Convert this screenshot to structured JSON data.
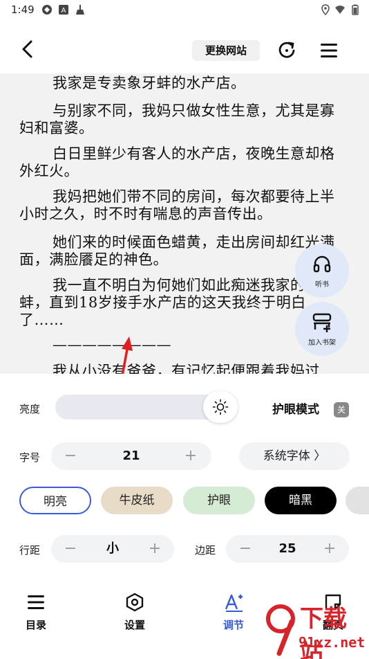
{
  "status_bar": {
    "time": "1:49"
  },
  "top_bar": {
    "switch_site": "更换网站"
  },
  "content": {
    "paragraphs": [
      "我家是专卖象牙蚌的水产店。",
      "与别家不同，我妈只做女性生意，尤其是寡妇和富婆。",
      "白日里鲜少有客人的水产店，夜晚生意却格外红火。",
      "我妈把她们带不同的房间，每次都要待上半小时之久，时不时有喘息的声音传出。",
      "她们来的时候面色蜡黄，走出房间却红光满面，满脸餍足的神色。",
      "我一直不明白为何她们如此痴迷我家的象牙蚌，直到18岁接手水产店的这天我终于明白了……",
      "————————",
      "我从小没有爸爸，有记忆起便跟着我妈过"
    ]
  },
  "floating": {
    "listen": "听书",
    "add_shelf": "加入书架"
  },
  "settings": {
    "brightness_label": "亮度",
    "eye_mode_label": "护眼模式",
    "eye_mode_state": "关",
    "font_size_label": "字号",
    "font_size_value": "21",
    "font_family_label": "系统字体 〉",
    "minus": "−",
    "plus": "+",
    "themes": [
      "明亮",
      "牛皮纸",
      "护眼",
      "暗黑"
    ],
    "line_spacing_label": "行距",
    "line_spacing_value": "小",
    "margin_label": "边距",
    "margin_value": "25"
  },
  "nav": {
    "items": [
      "目录",
      "设置",
      "调节",
      "翻页"
    ]
  },
  "watermark": {
    "brand": "下载站",
    "domain": "91xz.net"
  },
  "colors": {
    "accent": "#3a5bd9",
    "reader_bg": "#f2f2f2",
    "fab_bg": "#dfe9f8",
    "watermark": "#d8232a"
  }
}
